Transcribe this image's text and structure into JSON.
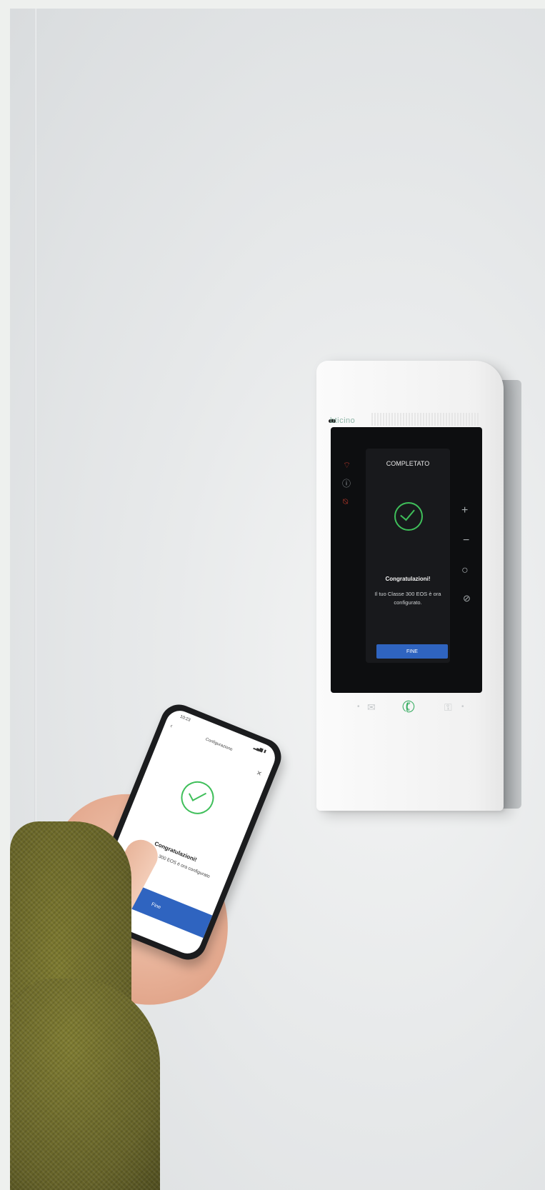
{
  "intercom": {
    "brand": "bticino",
    "screen": {
      "title": "COMPLETATO",
      "heading": "Congratulazioni!",
      "message": "Il tuo Classe 300 EOS è ora configurato.",
      "button": "FINE"
    },
    "controls": [
      "plus-icon",
      "minus-icon",
      "circle-icon",
      "mic-off-icon"
    ],
    "accent_color": "#3fbf5a",
    "button_color": "#2f64c0"
  },
  "phone": {
    "status_time": "10:23",
    "header_title": "Configurazione",
    "heading": "Congratulazioni!",
    "message": "Il tuo Classe 300 EOS è ora configurato",
    "button": "Fine"
  }
}
